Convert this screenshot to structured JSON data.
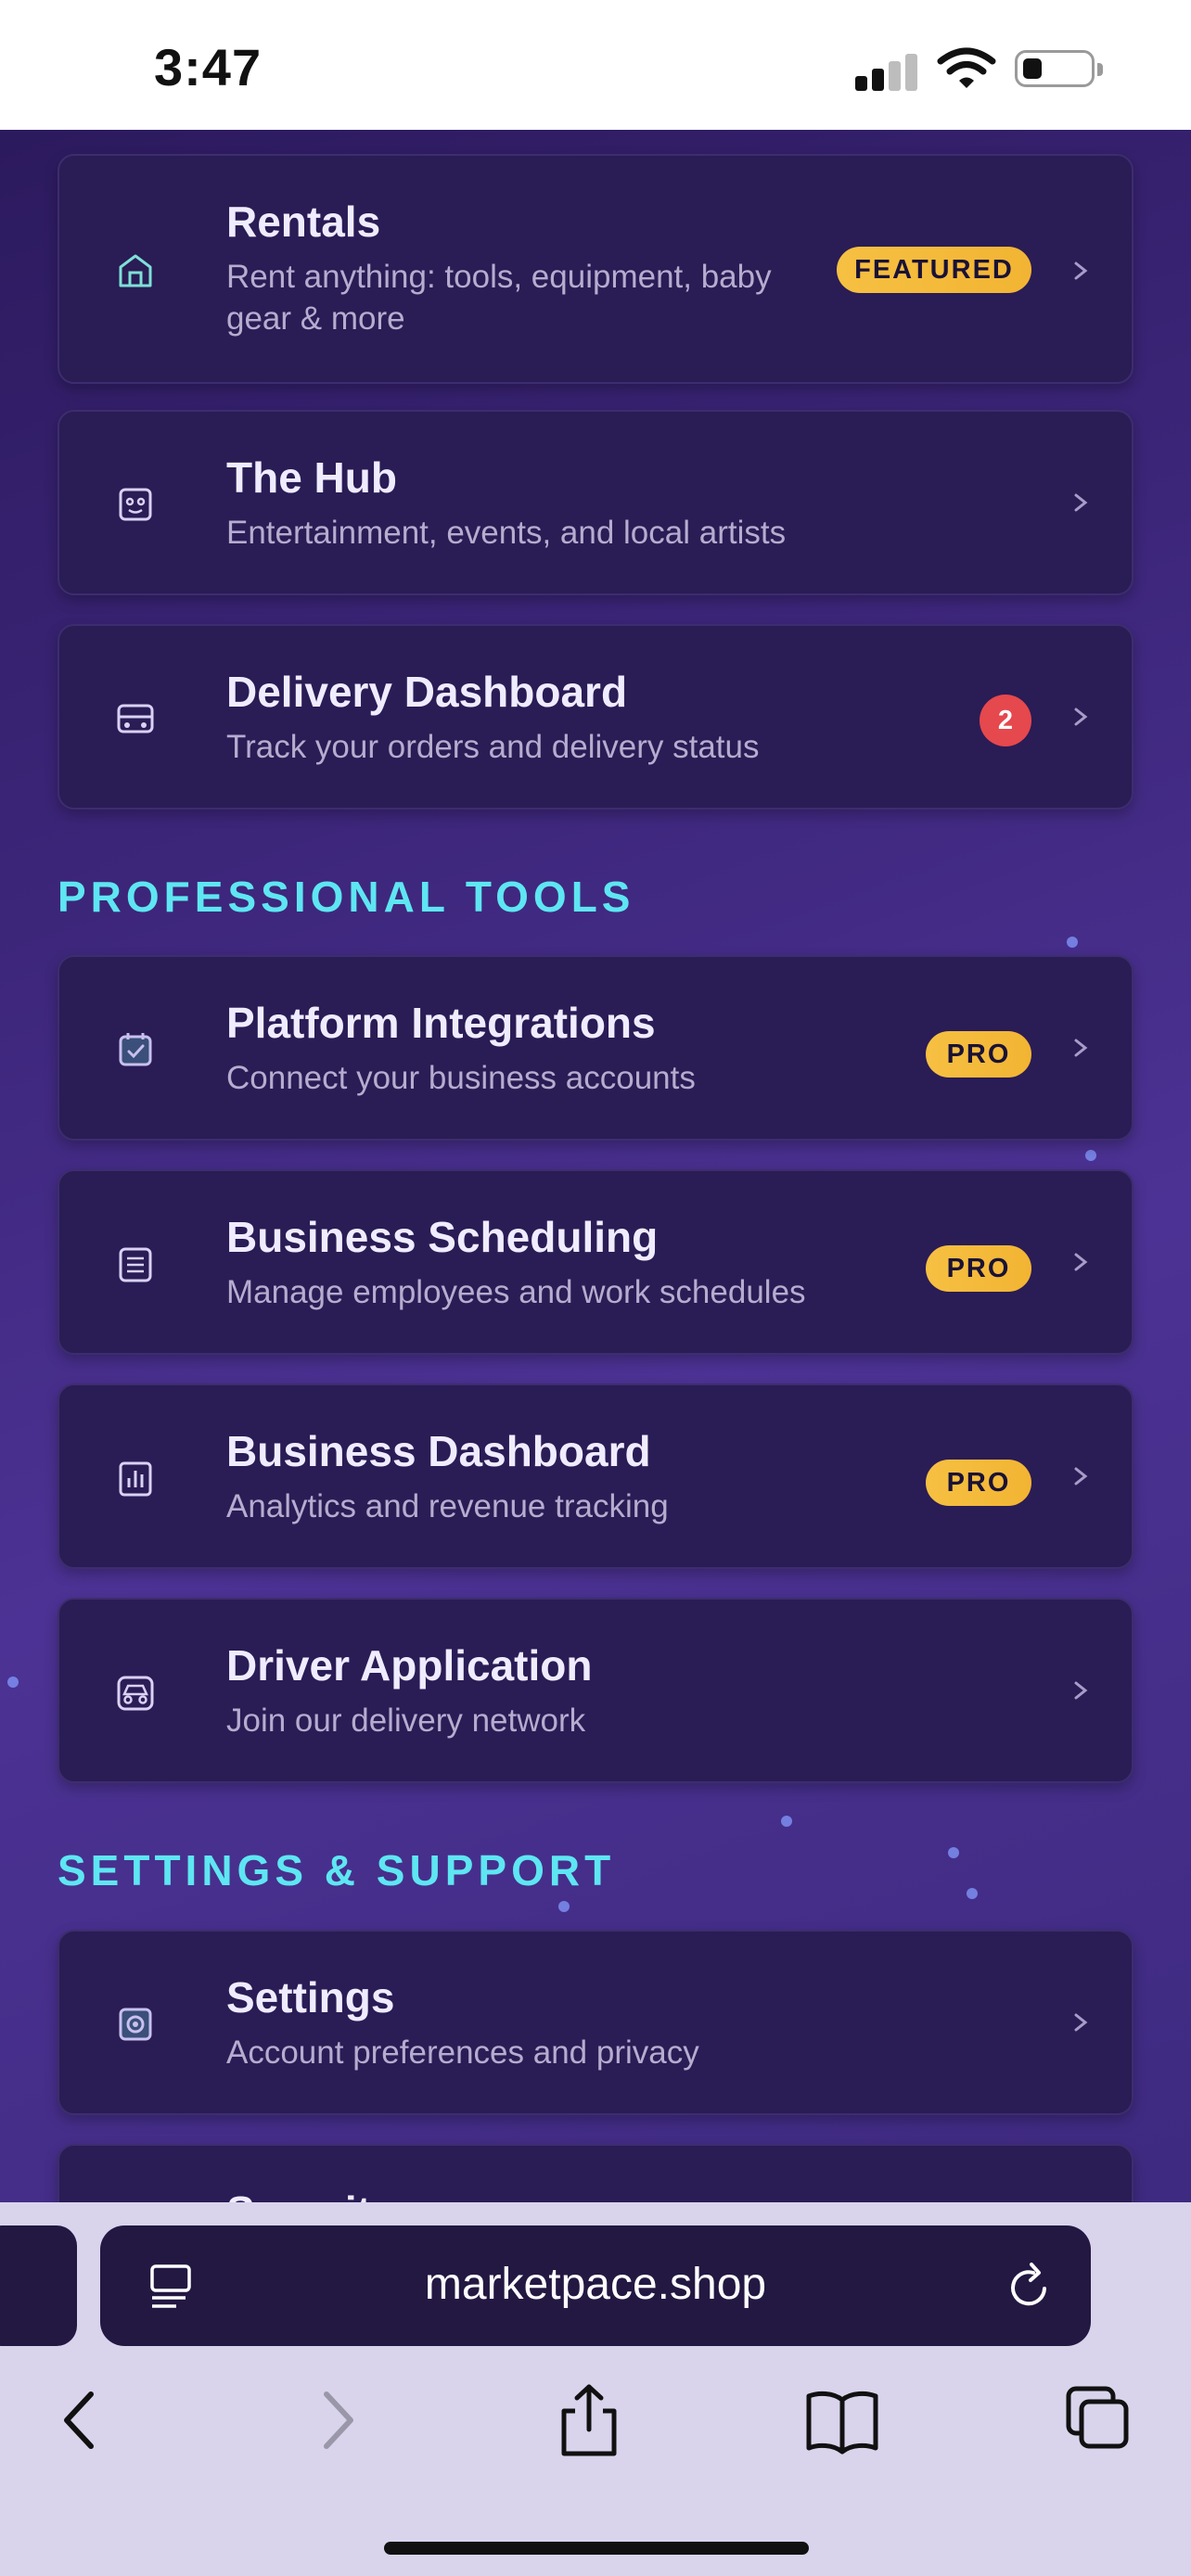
{
  "status_bar": {
    "time": "3:47"
  },
  "cards_top": [
    {
      "title": "Rentals",
      "subtitle": "Rent anything: tools, equipment, baby gear & more",
      "badge": "FEATURED",
      "icon": "home-icon"
    },
    {
      "title": "The Hub",
      "subtitle": "Entertainment, events, and local artists",
      "icon": "hub-icon"
    },
    {
      "title": "Delivery Dashboard",
      "subtitle": "Track your orders and delivery status",
      "count": "2",
      "icon": "truck-icon"
    }
  ],
  "sections": {
    "professional": "PROFESSIONAL TOOLS",
    "settings": "SETTINGS & SUPPORT"
  },
  "cards_pro": [
    {
      "title": "Platform Integrations",
      "subtitle": "Connect your business accounts",
      "badge": "PRO",
      "icon": "integration-icon"
    },
    {
      "title": "Business Scheduling",
      "subtitle": "Manage employees and work schedules",
      "badge": "PRO",
      "icon": "calendar-icon"
    },
    {
      "title": "Business Dashboard",
      "subtitle": "Analytics and revenue tracking",
      "badge": "PRO",
      "icon": "chart-icon"
    },
    {
      "title": "Driver Application",
      "subtitle": "Join our delivery network",
      "icon": "car-icon"
    }
  ],
  "cards_settings": [
    {
      "title": "Settings",
      "subtitle": "Account preferences and privacy",
      "icon": "gear-icon"
    },
    {
      "title": "Security",
      "subtitle": ""
    }
  ],
  "browser": {
    "url": "marketpace.shop"
  },
  "colors": {
    "accent_cyan": "#5ee6f2",
    "badge_gold": "#f6c042",
    "alert_red": "#e5484d",
    "card_bg": "#2a1c55"
  }
}
